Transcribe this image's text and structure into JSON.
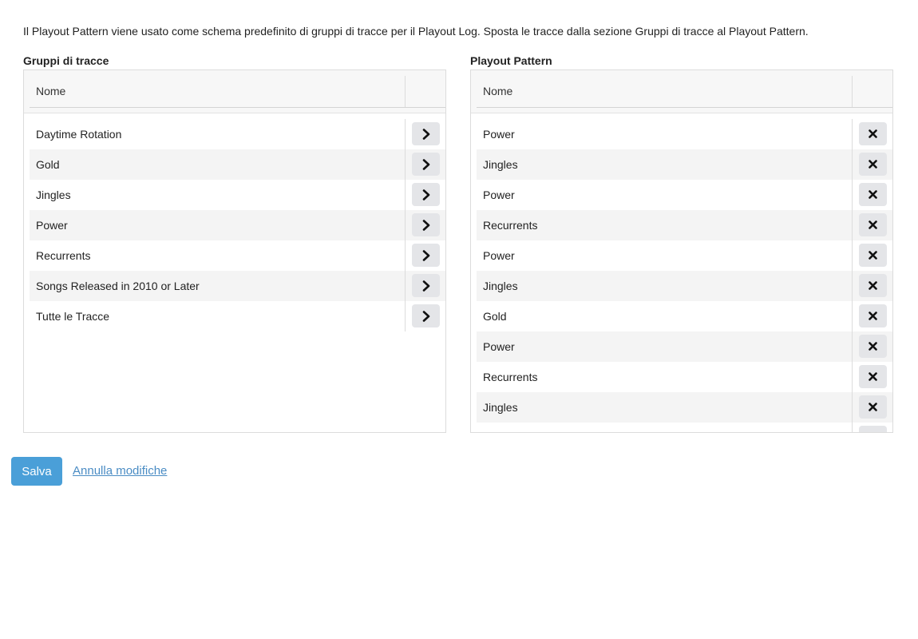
{
  "intro_text": "Il Playout Pattern viene usato come schema predefinito di gruppi di tracce per il Playout Log. Sposta le tracce dalla sezione Gruppi di tracce al Playout Pattern.",
  "track_groups": {
    "title": "Gruppi di tracce",
    "column_name": "Nome",
    "action_icon": "chevron-right-icon",
    "items": [
      "Daytime Rotation",
      "Gold",
      "Jingles",
      "Power",
      "Recurrents",
      "Songs Released in 2010 or Later",
      "Tutte le Tracce"
    ]
  },
  "playout_pattern": {
    "title": "Playout Pattern",
    "column_name": "Nome",
    "action_icon": "close-icon",
    "items": [
      "Power",
      "Jingles",
      "Power",
      "Recurrents",
      "Power",
      "Jingles",
      "Gold",
      "Power",
      "Recurrents",
      "Jingles",
      ""
    ]
  },
  "footer": {
    "save_label": "Salva",
    "cancel_label": "Annulla modifiche"
  },
  "colors": {
    "primary": "#4a9fd8",
    "link": "#4a8cc4",
    "row_alt": "#f4f4f4",
    "action_button": "#e4e5e8"
  }
}
